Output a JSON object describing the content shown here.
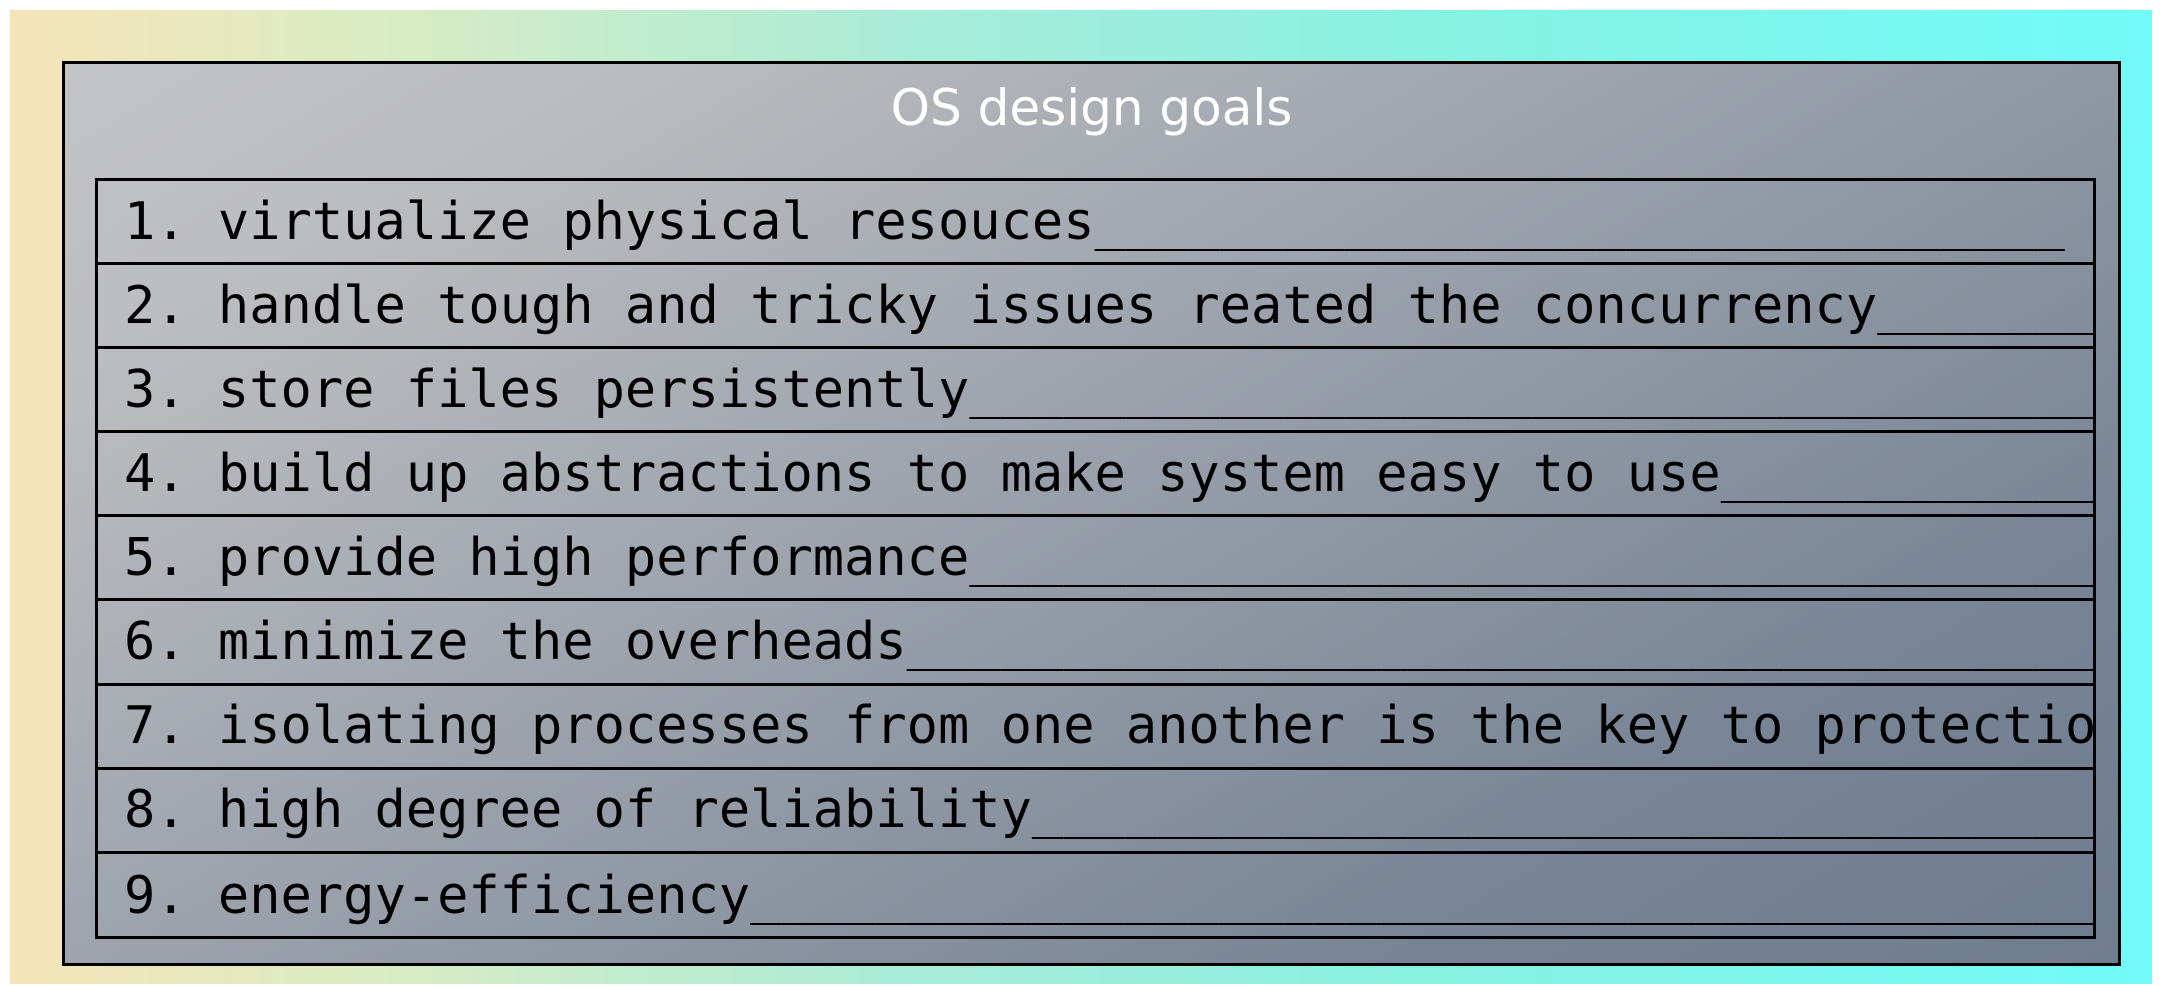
{
  "slide": {
    "title": "OS design goals",
    "items": [
      {
        "number": "1. ",
        "text": "virtualize physical resouces_______________________________"
      },
      {
        "number": "2. ",
        "text": "handle tough and tricky issues reated the concurrency_______"
      },
      {
        "number": "3. ",
        "text": "store files persistently____________________________________"
      },
      {
        "number": "4. ",
        "text": "build up abstractions to make system easy to use____________"
      },
      {
        "number": "5. ",
        "text": "provide high performance____________________________________"
      },
      {
        "number": "6. ",
        "text": "minimize the overheads______________________________________"
      },
      {
        "number": "7. ",
        "text": "isolating processes from one another is the key to protection"
      },
      {
        "number": "8. ",
        "text": "high degree of reliability__________________________________"
      },
      {
        "number": "9. ",
        "text": "energy-efficiency___________________________________________"
      }
    ],
    "colors": {
      "background_left": "#f6e4b8",
      "background_right": "#72fbf8",
      "panel_light": "#c2c3c4",
      "panel_dark": "#6f7d90",
      "title_text": "#ffffff",
      "item_text": "#000000",
      "border": "#000000"
    }
  }
}
